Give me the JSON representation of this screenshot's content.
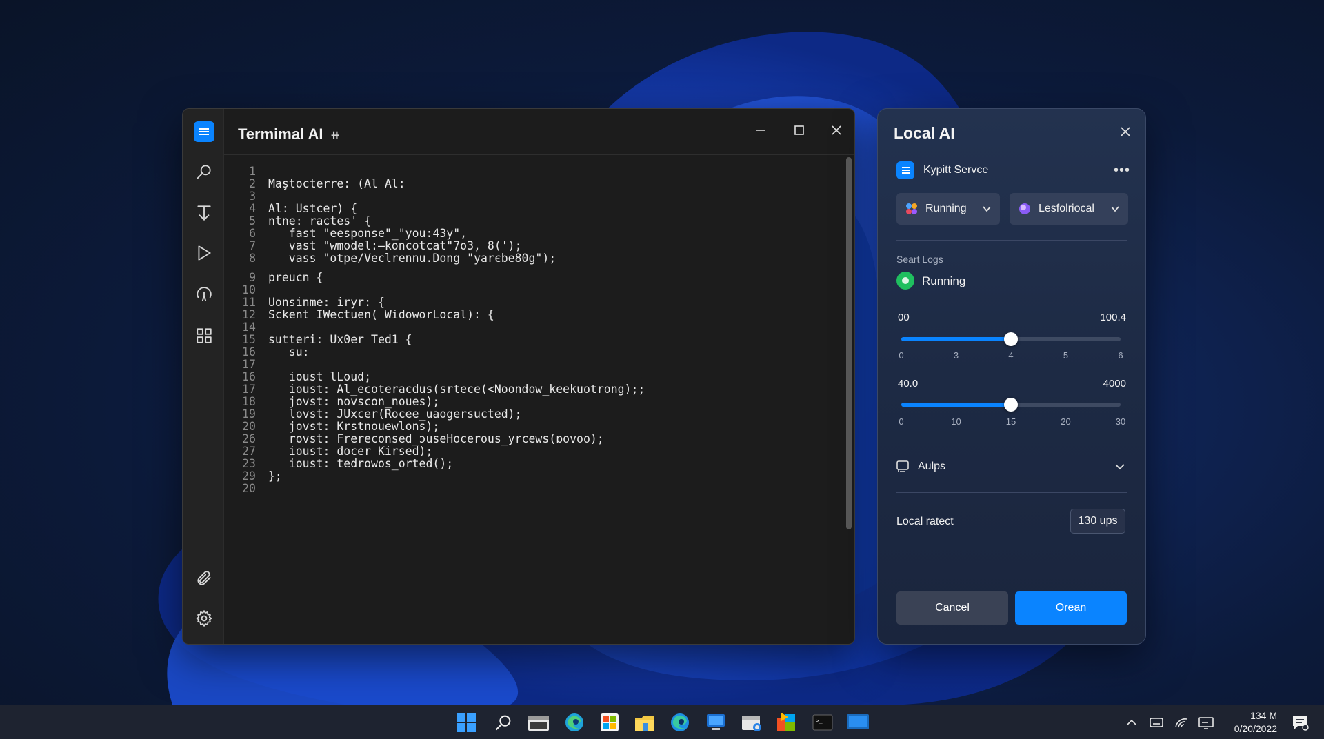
{
  "terminal": {
    "title": "Termimal AI",
    "title_icon": "pin-icon",
    "rail": [
      "search-icon",
      "download-icon",
      "play-icon",
      "history-icon",
      "apps-grid-icon",
      "paperclip-icon",
      "gear-icon"
    ],
    "lines": [
      {
        "n": "1",
        "t": ""
      },
      {
        "n": "2",
        "t": "Maştocterre: (Al Al:"
      },
      {
        "n": "3",
        "t": ""
      },
      {
        "n": "4",
        "t": "Al: Ustcer) {"
      },
      {
        "n": "5",
        "t": "ntne: ractes' {"
      },
      {
        "n": "6",
        "t": "   fast \"eesponse\"_\"you:43y\","
      },
      {
        "n": "7",
        "t": "   vast \"wmodel:—koncotcat\"7o3, 8(');"
      },
      {
        "n": "8",
        "t": "   vass \"otpe/Veclrennu.Dong \"yarєbe80g\");"
      },
      {
        "n": "9",
        "t": "preucn {"
      },
      {
        "n": "10",
        "t": ""
      },
      {
        "n": "11",
        "t": "Uonsinme: iryr: {"
      },
      {
        "n": "12",
        "t": "Sckent IWectuen( WidoworLocal): {"
      },
      {
        "n": "14",
        "t": ""
      },
      {
        "n": "15",
        "t": "sutteri: Ux0er Ted1 {"
      },
      {
        "n": "16",
        "t": "   su:"
      },
      {
        "n": "17",
        "t": ""
      },
      {
        "n": "16",
        "t": "   ioust lLoud;"
      },
      {
        "n": "17",
        "t": "   ioust: Al_ecoteracdus(srtece(<Noondow_keekuotrong);;"
      },
      {
        "n": "18",
        "t": "   jovst: novscon_noues);"
      },
      {
        "n": "19",
        "t": "   lovst: JUxcer(Rocee_uaogersucted);"
      },
      {
        "n": "20",
        "t": "   jovst: Krstnouewlons);"
      },
      {
        "n": "26",
        "t": "   rovst: Frereconsed_ɔuseHocerous_yrcews(ɒovoo);"
      },
      {
        "n": "27",
        "t": "   ioust: docer Kirsed);"
      },
      {
        "n": "23",
        "t": "   ioust: tedrowos_orted();"
      },
      {
        "n": "29",
        "t": "};"
      },
      {
        "n": "20",
        "t": ""
      }
    ]
  },
  "panel": {
    "title": "Local AI",
    "service_name": "Kypitt Servce",
    "status_dropdown": "Running",
    "model_dropdown": "Lesfolriocal",
    "logs_label": "Seart Logs",
    "logs_status": "Running",
    "slider1": {
      "min_label": "00",
      "max_label": "100.4",
      "ticks": [
        "0",
        "3",
        "4",
        "5",
        "6"
      ],
      "value": 0.5
    },
    "slider2": {
      "min_label": "40.0",
      "max_label": "4000",
      "ticks": [
        "0",
        "10",
        "15",
        "20",
        "30"
      ],
      "value": 0.5
    },
    "section_label": "Aulps",
    "rate_label": "Local ratect",
    "rate_value": "130 ups",
    "cancel_label": "Cancel",
    "open_label": "Orean"
  },
  "taskbar": {
    "apps": [
      "windows-start-icon",
      "search-icon",
      "file-explorer-icon",
      "edge-icon",
      "store-icon",
      "folder-icon",
      "edge-icon",
      "display-icon",
      "mail-icon",
      "office-icon",
      "terminal-icon",
      "screen-icon"
    ],
    "clock_time": "134 M",
    "clock_date": "0/20/2022"
  },
  "colors": {
    "accent": "#0a84ff",
    "running": "#1fbf5f"
  }
}
